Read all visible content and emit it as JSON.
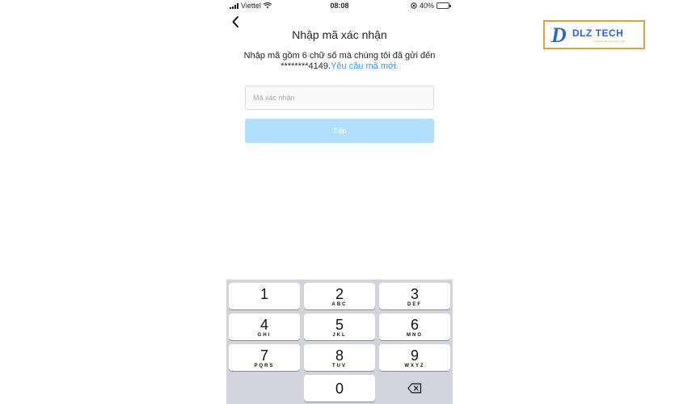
{
  "status_bar": {
    "carrier": "Viettel",
    "time": "08:08",
    "battery": "40%",
    "battery_level": 0.4
  },
  "header": {
    "title": "Nhập mã xác nhận"
  },
  "description": {
    "line1": "Nhập mã gồm 6 chữ số mà chúng tôi đã gửi đến",
    "masked": "********4149.",
    "resend_link": "Yêu cầu mã mới."
  },
  "code_input": {
    "placeholder": "Mã xác nhận",
    "value": ""
  },
  "next_button": {
    "label": "Tiếp"
  },
  "logo": {
    "letter": "D",
    "text": "DLZ TECH",
    "tagline": "Cùng bạn làm chủ công nghệ"
  },
  "keypad": {
    "keys": [
      {
        "num": "1",
        "letters": ""
      },
      {
        "num": "2",
        "letters": "ABC"
      },
      {
        "num": "3",
        "letters": "DEF"
      },
      {
        "num": "4",
        "letters": "GHI"
      },
      {
        "num": "5",
        "letters": "JKL"
      },
      {
        "num": "6",
        "letters": "MNO"
      },
      {
        "num": "7",
        "letters": "PQRS"
      },
      {
        "num": "8",
        "letters": "TUV"
      },
      {
        "num": "9",
        "letters": "WXYZ"
      },
      {
        "num": "0",
        "letters": ""
      }
    ]
  },
  "colors": {
    "link": "#3897f0",
    "button": "#b2dffc",
    "keypad_bg": "#d1d4da",
    "logo_blue": "#2c64c9",
    "logo_gold": "#d9a441"
  },
  "icons": {
    "back": "chevron-left-icon",
    "delete": "backspace-icon",
    "wifi": "wifi-icon",
    "signal": "signal-bars-icon",
    "battery": "battery-icon",
    "location": "location-icon"
  }
}
